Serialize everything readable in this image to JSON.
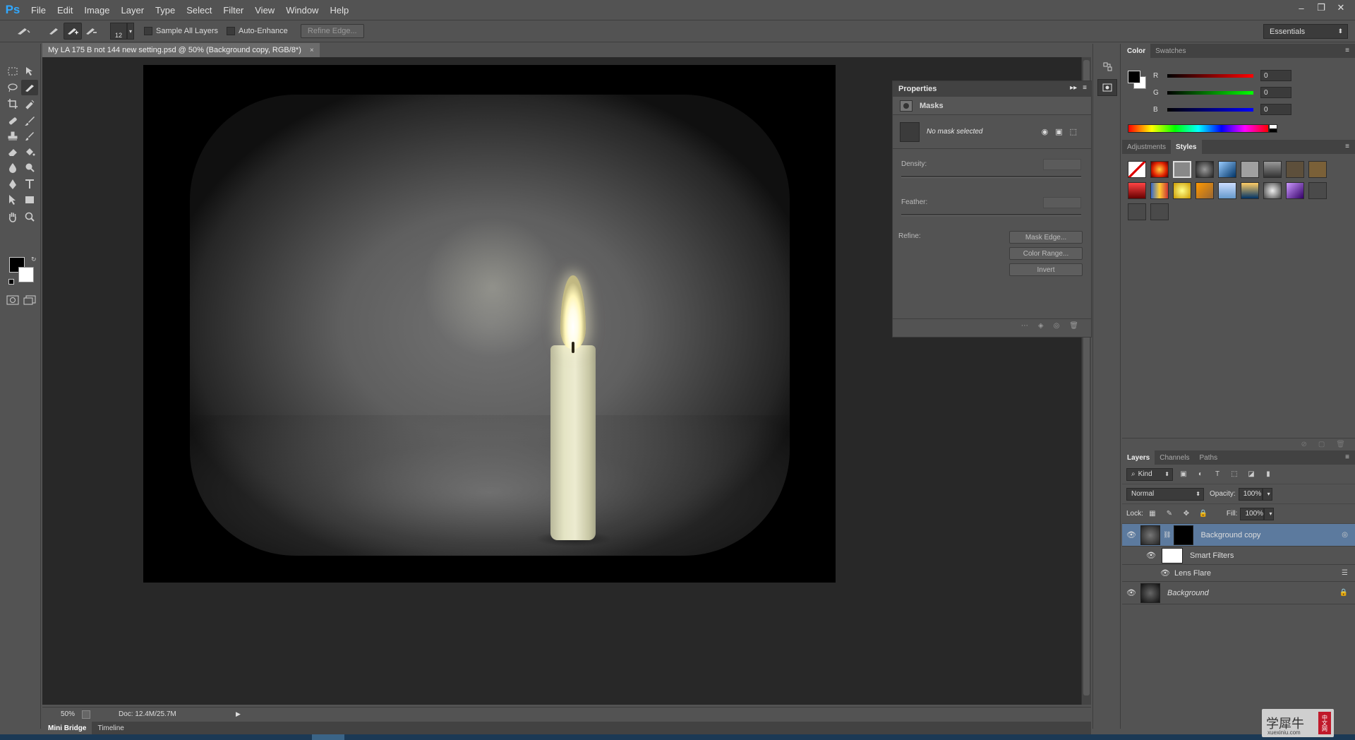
{
  "app": {
    "logo": "Ps"
  },
  "menu": [
    "File",
    "Edit",
    "Image",
    "Layer",
    "Type",
    "Select",
    "Filter",
    "View",
    "Window",
    "Help"
  ],
  "window_controls": [
    "–",
    "❐",
    "✕"
  ],
  "options": {
    "brush_size": "12",
    "sample_all_layers": "Sample All Layers",
    "auto_enhance": "Auto-Enhance",
    "refine_edge": "Refine Edge...",
    "workspace": "Essentials"
  },
  "document": {
    "tab_title": "My LA 175 B not 144 new setting.psd @ 50% (Background copy, RGB/8*)",
    "close": "×"
  },
  "status": {
    "zoom": "50%",
    "doc_size": "Doc: 12.4M/25.7M"
  },
  "bottom_tabs": [
    "Mini Bridge",
    "Timeline"
  ],
  "properties": {
    "title": "Properties",
    "section": "Masks",
    "no_mask": "No mask selected",
    "density_label": "Density:",
    "feather_label": "Feather:",
    "refine_label": "Refine:",
    "mask_edge": "Mask Edge...",
    "color_range": "Color Range...",
    "invert": "Invert"
  },
  "color_panel": {
    "tabs": [
      "Color",
      "Swatches"
    ],
    "r_label": "R",
    "r_value": "0",
    "g_label": "G",
    "g_value": "0",
    "b_label": "B",
    "b_value": "0",
    "fg_color": "#000000",
    "bg_color": "#ffffff"
  },
  "styles_panel": {
    "tabs": [
      "Adjustments",
      "Styles"
    ]
  },
  "layers_panel": {
    "tabs": [
      "Layers",
      "Channels",
      "Paths"
    ],
    "kind": "Kind",
    "blend_mode": "Normal",
    "opacity_label": "Opacity:",
    "opacity_value": "100%",
    "lock_label": "Lock:",
    "fill_label": "Fill:",
    "fill_value": "100%",
    "layers": [
      {
        "name": "Background copy"
      },
      {
        "name": "Smart Filters"
      },
      {
        "name": "Lens Flare"
      },
      {
        "name": "Background"
      }
    ]
  },
  "watermark": {
    "text": "学犀牛",
    "seal": "中文网",
    "url": "xuexiniu.com"
  },
  "colors": {
    "selected_layer": "#5c7a9e",
    "accent_blue": "#31a8ff"
  }
}
